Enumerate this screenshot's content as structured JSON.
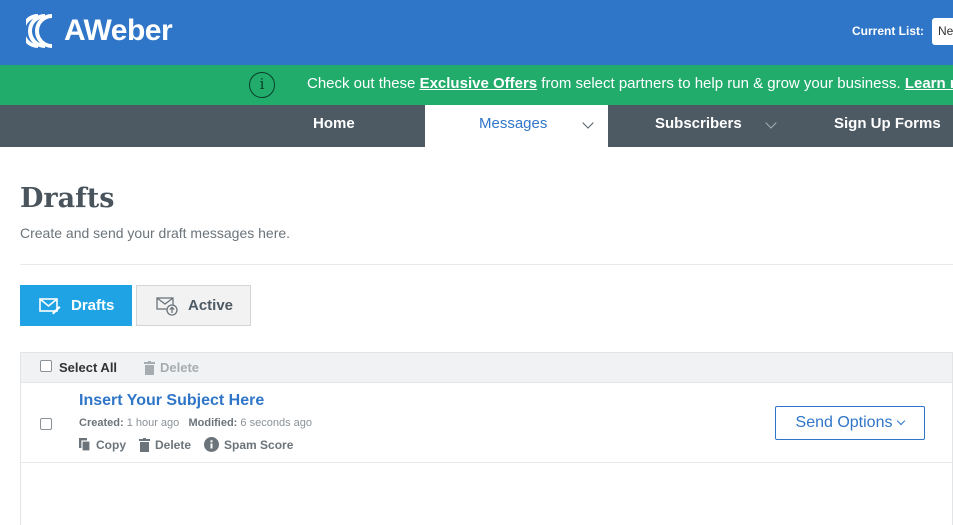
{
  "header": {
    "logo_text": "AWeber",
    "current_list_label": "Current List:",
    "current_list_value": "Ne"
  },
  "promo": {
    "icon": "info-icon",
    "text_before": "Check out these ",
    "link_offers": "Exclusive Offers",
    "text_middle": " from select partners to help run & grow your business. ",
    "link_learn": "Learn mo"
  },
  "nav": {
    "home": "Home",
    "messages": "Messages",
    "subscribers": "Subscribers",
    "signup_forms": "Sign Up Forms"
  },
  "page": {
    "title": "Drafts",
    "subtitle": "Create and send your draft messages here."
  },
  "tabs": {
    "drafts": "Drafts",
    "active": "Active"
  },
  "table": {
    "select_all": "Select All",
    "delete": "Delete",
    "rows": [
      {
        "subject": "Insert Your Subject Here",
        "created_label": "Created:",
        "created_value": "1 hour ago",
        "modified_label": "Modified:",
        "modified_value": "6 seconds ago",
        "copy": "Copy",
        "delete": "Delete",
        "spam_score": "Spam Score",
        "send_options": "Send Options"
      }
    ]
  },
  "colors": {
    "brand_blue": "#2f76c8",
    "promo_green": "#21ac6c",
    "nav_gray": "#4d5a64",
    "tab_active_blue": "#1fa3e4"
  }
}
